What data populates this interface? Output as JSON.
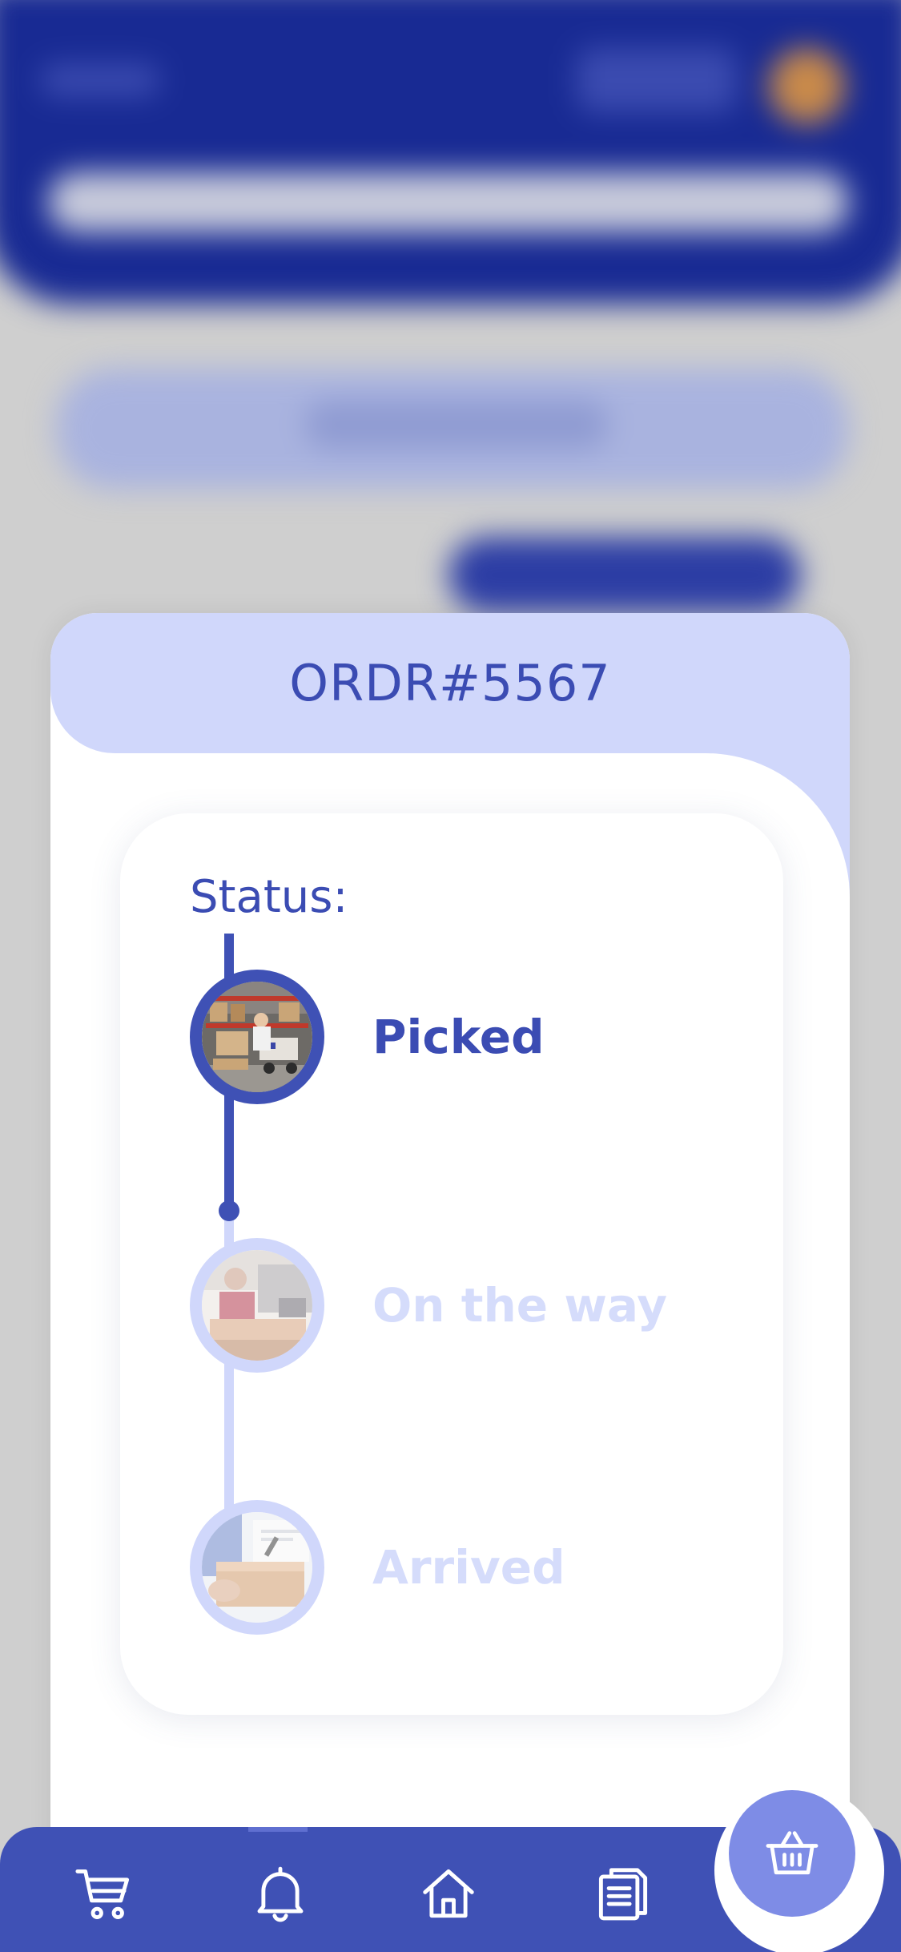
{
  "order": {
    "number": "ORDR#5567",
    "status_label": "Status:"
  },
  "steps": [
    {
      "label": "Picked",
      "state": "done",
      "icon": "warehouse-photo"
    },
    {
      "label": "On the way",
      "state": "pending",
      "icon": "delivery-van-photo"
    },
    {
      "label": "Arrived",
      "state": "pending",
      "icon": "package-handover-photo"
    }
  ],
  "bottom_nav": {
    "items": [
      {
        "icon": "cart-icon"
      },
      {
        "icon": "bell-icon",
        "active": true
      },
      {
        "icon": "home-icon"
      },
      {
        "icon": "documents-icon"
      }
    ],
    "fab_icon": "basket-icon"
  },
  "colors": {
    "primary": "#3f51b5",
    "header_blue": "#182a93",
    "light_accent": "#d0d7fb",
    "fab": "#7e8ce6",
    "text_primary": "#3b4cb3",
    "text_pending": "#d5dcfb"
  }
}
